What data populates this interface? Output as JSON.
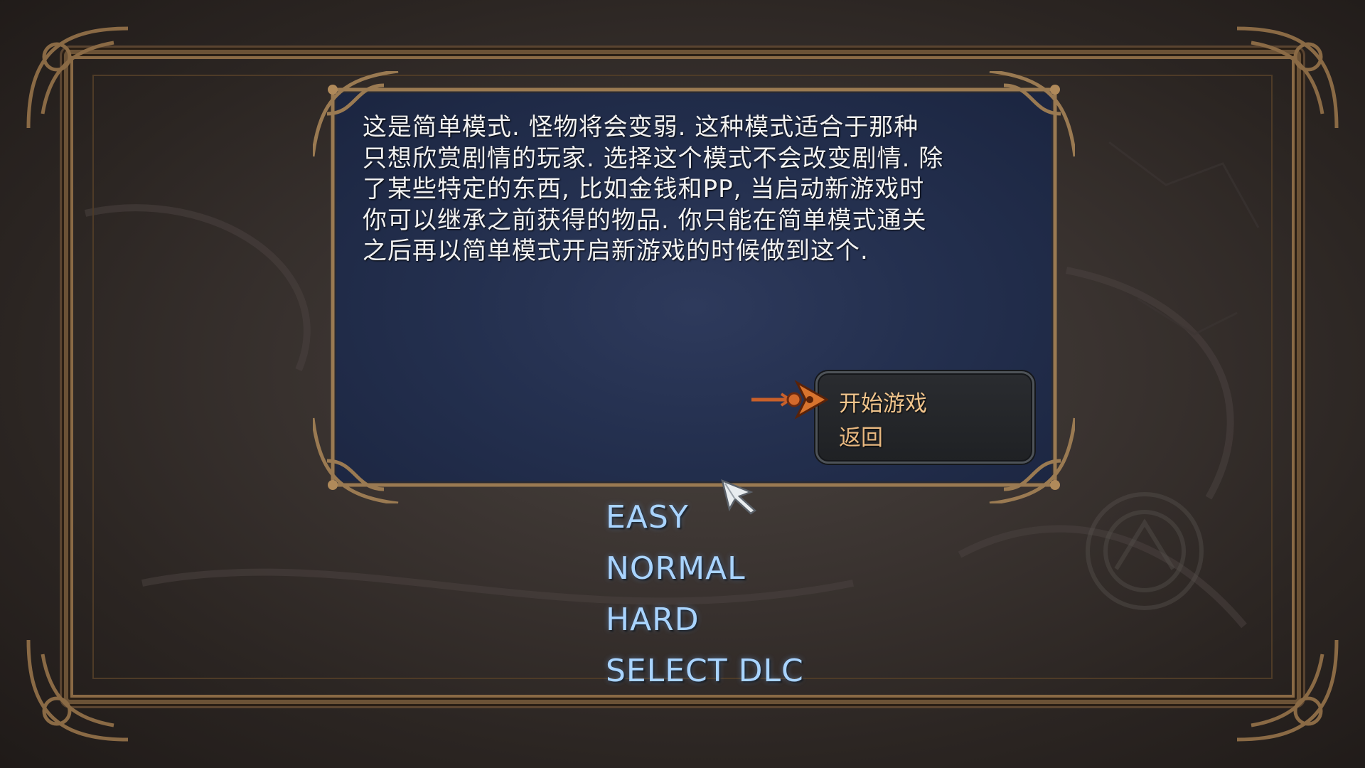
{
  "dialog": {
    "description": "这是简单模式. 怪物将会变弱. 这种模式适合于那种\n只想欣赏剧情的玩家. 选择这个模式不会改变剧情. 除\n了某些特定的东西, 比如金钱和PP, 当启动新游戏时\n你可以继承之前获得的物品. 你只能在简单模式通关\n之后再以简单模式开启新游戏的时候做到这个."
  },
  "confirm_menu": {
    "options": [
      {
        "label": "开始游戏",
        "selected": true
      },
      {
        "label": "返回",
        "selected": false
      }
    ],
    "pointer_icon": "arrow-pointer-icon"
  },
  "difficulty_menu": {
    "items": [
      {
        "label": "EASY"
      },
      {
        "label": "NORMAL"
      },
      {
        "label": "HARD"
      },
      {
        "label": "SELECT DLC"
      }
    ]
  },
  "colors": {
    "description_text": "#f2f2f2",
    "menu_text": "#a9d4ff",
    "option_text": "#e8b880",
    "panel_bg": "#24304f",
    "frame": "#6b5236"
  },
  "icons": {
    "cursor": "winged-cursor-icon"
  }
}
